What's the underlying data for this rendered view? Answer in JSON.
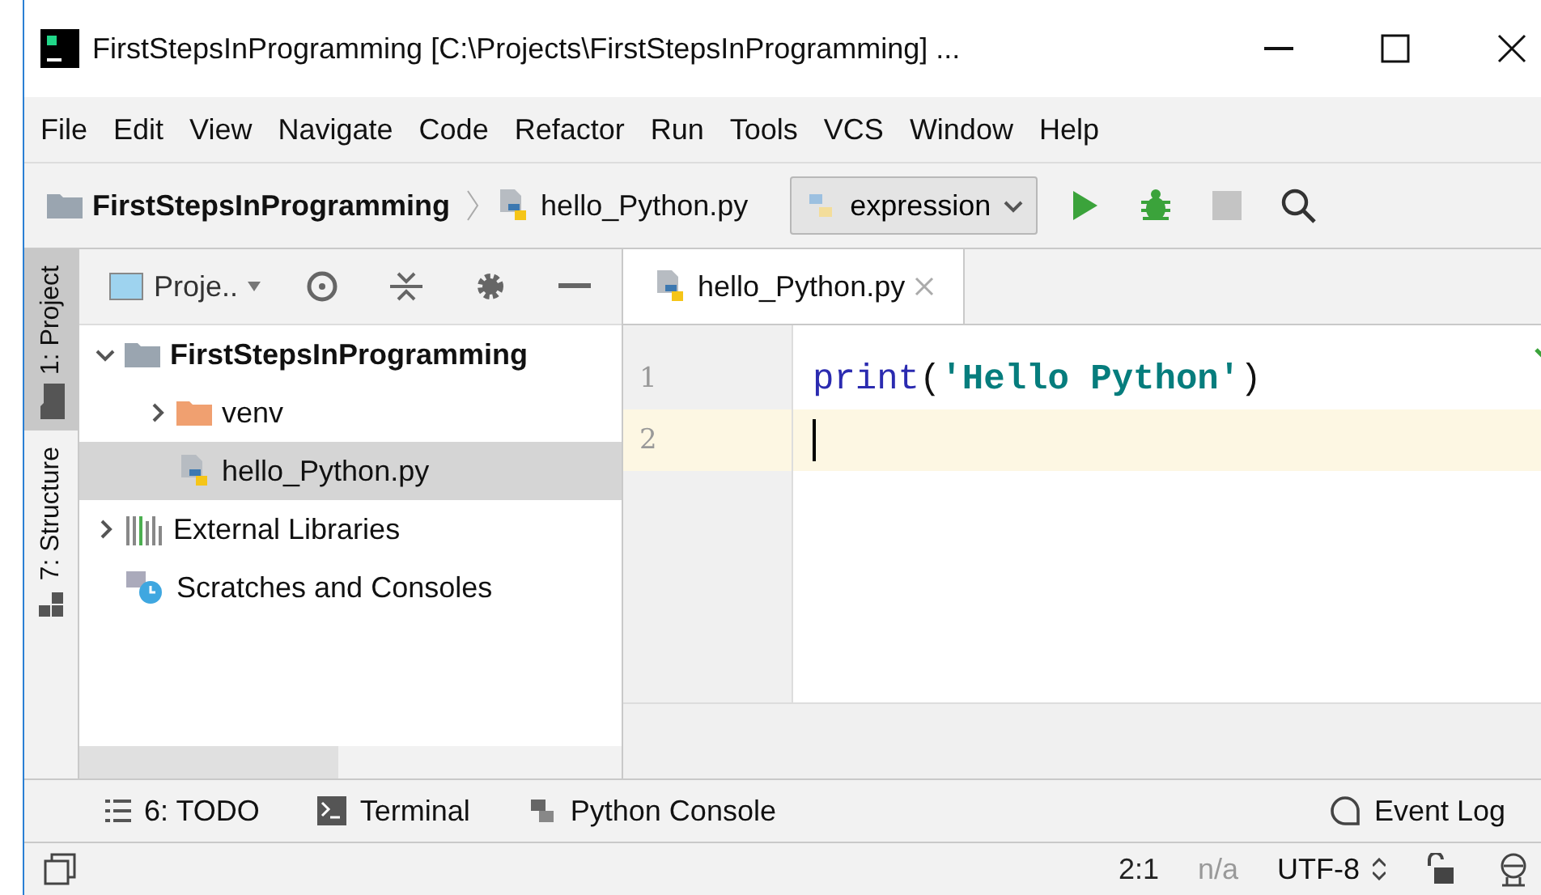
{
  "window": {
    "title": "FirstStepsInProgramming [C:\\Projects\\FirstStepsInProgramming] ..."
  },
  "menu": [
    "File",
    "Edit",
    "View",
    "Navigate",
    "Code",
    "Refactor",
    "Run",
    "Tools",
    "VCS",
    "Window",
    "Help"
  ],
  "navbar": {
    "breadcrumbs": [
      {
        "label": "FirstStepsInProgramming",
        "kind": "folder"
      },
      {
        "label": "hello_Python.py",
        "kind": "python"
      }
    ],
    "run_config": "expression"
  },
  "side_tabs": [
    {
      "label": "1: Project",
      "selected": true,
      "kind": "folder"
    },
    {
      "label": "7: Structure",
      "selected": false,
      "kind": "structure"
    }
  ],
  "project_panel": {
    "title": "Proje..",
    "tree": [
      {
        "label": "FirstStepsInProgramming",
        "kind": "root",
        "expanded": true,
        "selected": false,
        "children": [
          {
            "label": "venv",
            "kind": "venv",
            "expanded": false,
            "selected": false
          },
          {
            "label": "hello_Python.py",
            "kind": "python",
            "selected": true
          }
        ]
      },
      {
        "label": "External Libraries",
        "kind": "library",
        "expanded": false,
        "selected": false
      },
      {
        "label": "Scratches and Consoles",
        "kind": "scratch",
        "selected": false
      }
    ]
  },
  "editor": {
    "tabs": [
      {
        "label": "hello_Python.py",
        "selected": true
      }
    ],
    "lines": [
      {
        "number": "1",
        "current": false,
        "tokens": [
          {
            "kind": "keyword",
            "text": "print"
          },
          {
            "kind": "punct",
            "text": "("
          },
          {
            "kind": "string",
            "text": "'Hello Python'"
          },
          {
            "kind": "punct",
            "text": ")"
          }
        ]
      },
      {
        "number": "2",
        "current": true
      }
    ]
  },
  "tool_windows": [
    {
      "label": "6: TODO",
      "kind": "todo"
    },
    {
      "label": "Terminal",
      "kind": "terminal"
    },
    {
      "label": "Python Console",
      "kind": "python"
    }
  ],
  "event_log": "Event Log",
  "status_bar": {
    "position": "2:1",
    "line_separator": "n/a",
    "encoding": "UTF-8"
  }
}
